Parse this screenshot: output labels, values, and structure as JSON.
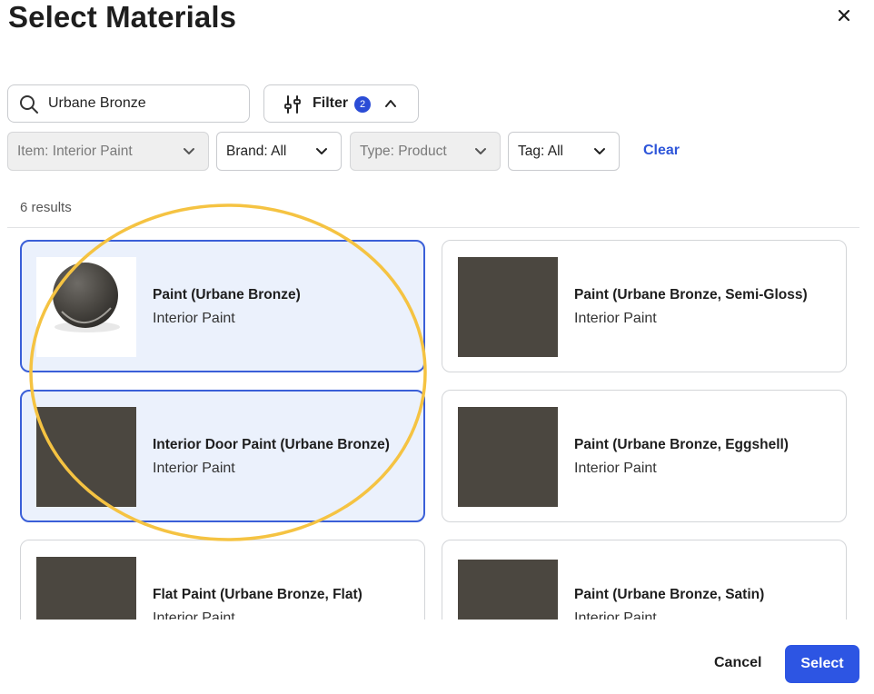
{
  "dialog": {
    "title": "Select Materials",
    "close_icon": "close-icon"
  },
  "search": {
    "value": "Urbane Bronze",
    "icon": "search-icon"
  },
  "filter": {
    "label": "Filter",
    "count": "2",
    "icon": "sliders-icon",
    "toggle_icon": "chevron-up-icon"
  },
  "dropdowns": [
    {
      "label": "Item: Interior Paint",
      "disabled": true
    },
    {
      "label": "Brand: All",
      "disabled": false
    },
    {
      "label": "Type: Product",
      "disabled": true
    },
    {
      "label": "Tag: All",
      "disabled": false
    }
  ],
  "clear_label": "Clear",
  "results_count": "6 results",
  "cards": [
    {
      "name": "Paint (Urbane Bronze)",
      "subtitle": "Interior Paint",
      "selected": true,
      "thumb": "paint-ball"
    },
    {
      "name": "Paint (Urbane Bronze, Semi-Gloss)",
      "subtitle": "Interior Paint",
      "selected": false,
      "thumb": "swatch"
    },
    {
      "name": "Interior Door Paint (Urbane Bronze)",
      "subtitle": "Interior Paint",
      "selected": true,
      "thumb": "swatch"
    },
    {
      "name": "Paint (Urbane Bronze, Eggshell)",
      "subtitle": "Interior Paint",
      "selected": false,
      "thumb": "swatch"
    },
    {
      "name": "Flat Paint (Urbane Bronze, Flat)",
      "subtitle": "Interior Paint",
      "selected": false,
      "thumb": "swatch"
    },
    {
      "name": "Paint (Urbane Bronze, Satin)",
      "subtitle": "Interior Paint",
      "selected": false,
      "thumb": "swatch"
    }
  ],
  "footer": {
    "cancel_label": "Cancel",
    "select_label": "Select"
  },
  "colors": {
    "accent": "#2d55e3",
    "swatch": "#4b4740",
    "selected_bg": "#ebf1fc",
    "annotation": "#f5c342"
  }
}
